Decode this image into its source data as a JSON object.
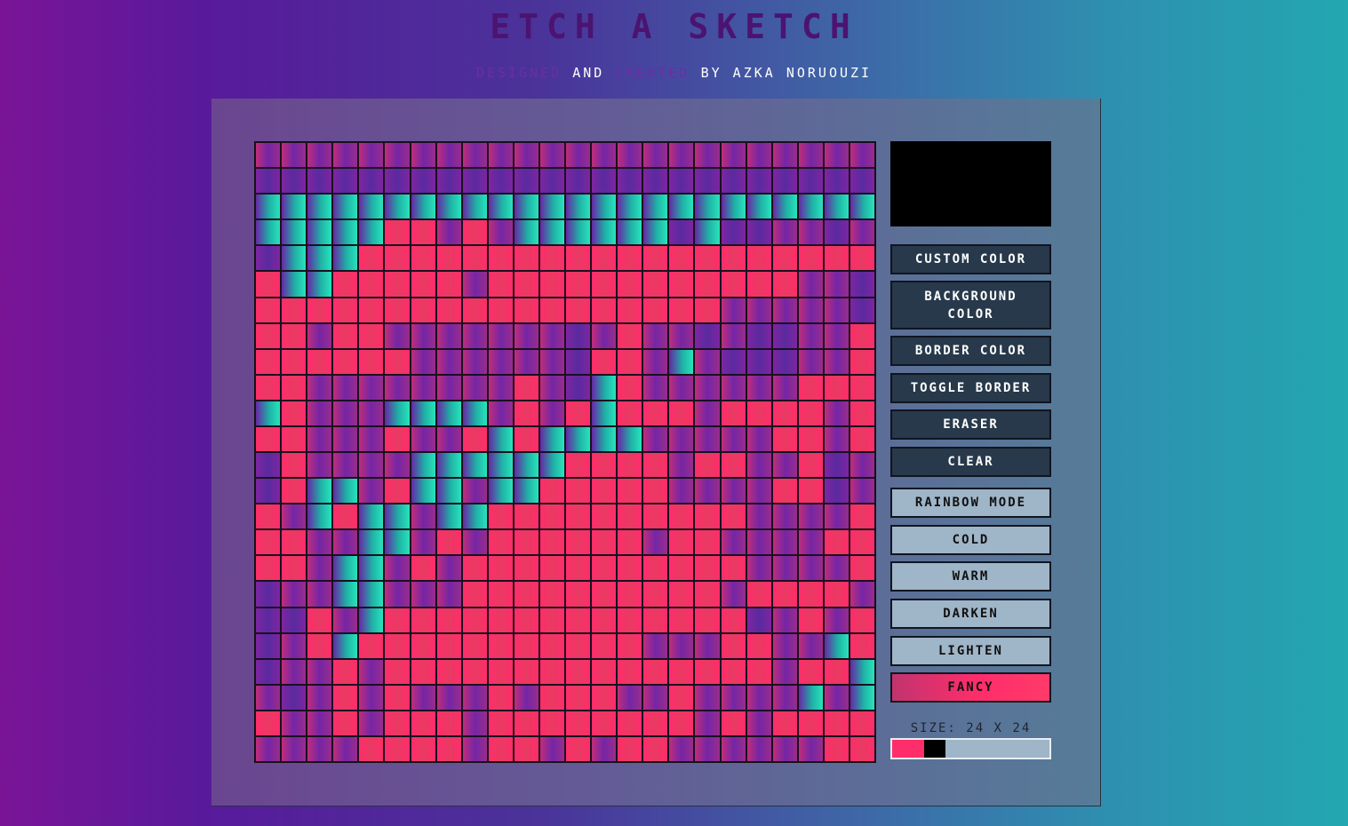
{
  "header": {
    "title": "Etch a Sketch",
    "subtitle": {
      "part1": "designed",
      "part2": " and ",
      "part3": "created",
      "part4": " by ",
      "part5": "azka noruouzi"
    }
  },
  "grid": {
    "size": 24,
    "rows": [
      "vvvvvvvvvvvvvvvvvvvvvvvv",
      "mmmmmmmmmmmmmmmmmmmmmmmm",
      "cccccccccccccccccccccccc",
      "cccccppvpvccccccmcmmvvmv",
      "mcccpppppppppppppppppppp",
      "pccpppppvppppppppppppvvm",
      "ppppppppppppppppppvvvvvm",
      "ppvppvvvvvvvmvpvvmvmmvvp",
      "ppppppvvvvvvmppvcvmmmvvp",
      "ppvvvvvvvvpvmcpvvvvvvppp",
      "cpvvvccccvpvpcpppvppppvp",
      "ppvvvpvvpcpccccvvvvvppvp",
      "mpvvvvccccccppppvppvvpmv",
      "mpccvpccvccpppppvvvvppmv",
      "pvcpccvccppppppppppvvvvp",
      "ppvvccvpvppppppvppvvvvpp",
      "ppvccvpvpppppppppppvvvvp",
      "mvvccvvvppppppppppvppppv",
      "mmpvcppppppppppppppmvpvp",
      "mvpcpppppppppppvvvppvvcp",
      "mvvpvpppppppppppppppvppc",
      "vmvpvpvvvpvpppvvpvvvvcvc",
      "pvvpvpppvppppppppvpvpppp",
      "vvvvppppvppvpvppvvvvvvpp"
    ]
  },
  "preview": {
    "color": "#000000"
  },
  "buttons": {
    "custom_color": "custom color",
    "background_color": "background color",
    "border_color": "border color",
    "toggle_border": "toggle border",
    "eraser": "eraser",
    "clear": "clear",
    "rainbow_mode": "rainbow mode",
    "cold": "cold",
    "warm": "warm",
    "darken": "darken",
    "lighten": "lighten",
    "fancy": "fancy"
  },
  "size": {
    "label": "Size: 24 x 24",
    "value": 24,
    "min": 1,
    "max": 100
  }
}
